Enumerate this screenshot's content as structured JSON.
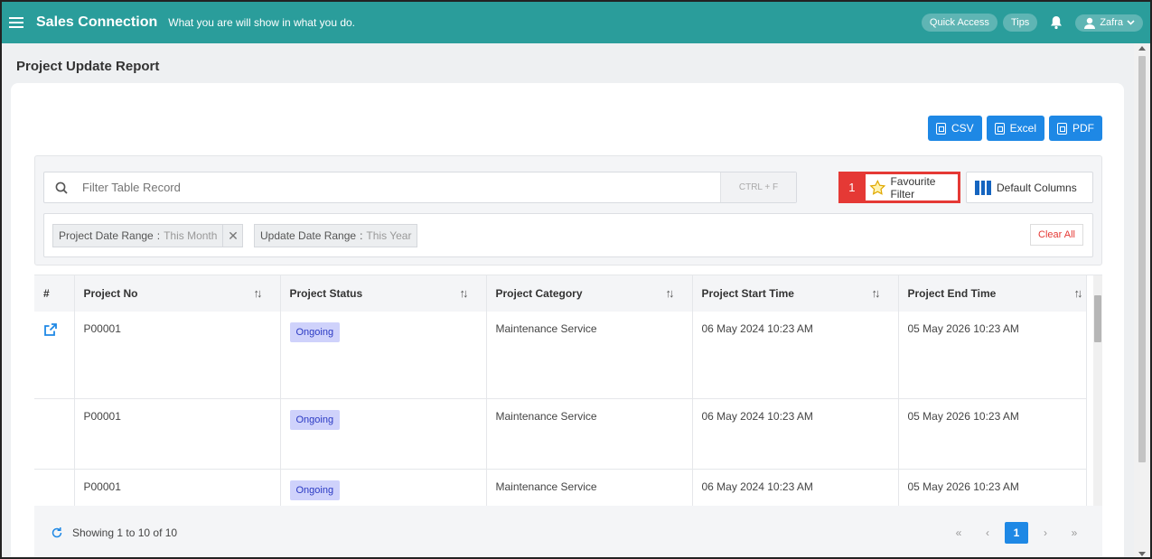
{
  "topbar": {
    "app_title": "Sales Connection",
    "tagline": "What you are will show in what you do.",
    "quick_access": "Quick Access",
    "tips": "Tips",
    "user_name": "Zafra",
    "icons": {
      "menu": "hamburger-icon",
      "bell": "bell-icon",
      "user": "user-icon",
      "caret": "chevron-down-icon"
    }
  },
  "page": {
    "title": "Project Update Report"
  },
  "exports": {
    "csv": "CSV",
    "excel": "Excel",
    "pdf": "PDF"
  },
  "filters": {
    "search_placeholder": "Filter Table Record",
    "shortcut": "CTRL + F",
    "favourite_number": "1",
    "favourite_label": "Favourite Filter",
    "default_columns_label": "Default Columns",
    "chips": [
      {
        "label": "Project Date Range",
        "sep": ":",
        "value": "This Month"
      },
      {
        "label": "Update Date Range",
        "sep": ":",
        "value": "This Year"
      }
    ],
    "clear_all": "Clear All"
  },
  "table": {
    "columns": [
      "#",
      "Project No",
      "Project Status",
      "Project Category",
      "Project Start Time",
      "Project End Time"
    ],
    "rows": [
      {
        "project_no": "P00001",
        "status": "Ongoing",
        "category": "Maintenance Service",
        "start": "06 May 2024 10:23 AM",
        "end": "05 May 2026 10:23 AM"
      },
      {
        "project_no": "P00001",
        "status": "Ongoing",
        "category": "Maintenance Service",
        "start": "06 May 2024 10:23 AM",
        "end": "05 May 2026 10:23 AM"
      },
      {
        "project_no": "P00001",
        "status": "Ongoing",
        "category": "Maintenance Service",
        "start": "06 May 2024 10:23 AM",
        "end": "05 May 2026 10:23 AM"
      }
    ]
  },
  "footer": {
    "showing": "Showing 1 to 10 of 10",
    "pagination": {
      "first": "«",
      "prev": "‹",
      "current": "1",
      "next": "›",
      "last": "»"
    }
  },
  "colors": {
    "topbar": "#2a9d9b",
    "primary": "#1e88e5",
    "highlight": "#e53935",
    "badge_bg": "#cfd2fb",
    "badge_text": "#2b3ac4"
  }
}
